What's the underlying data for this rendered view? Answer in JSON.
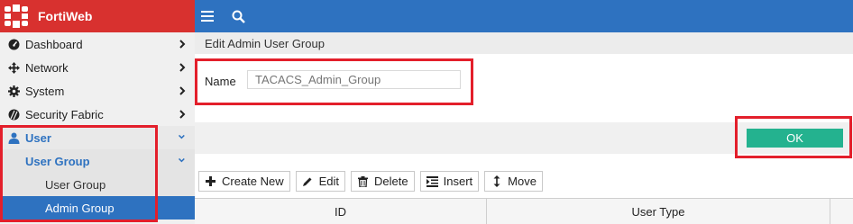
{
  "app": {
    "name": "FortiWeb"
  },
  "sidebar": {
    "items": [
      {
        "label": "Dashboard",
        "icon": "dashboard-icon"
      },
      {
        "label": "Network",
        "icon": "network-icon"
      },
      {
        "label": "System",
        "icon": "gear-icon"
      },
      {
        "label": "Security Fabric",
        "icon": "security-fabric-icon"
      },
      {
        "label": "User",
        "icon": "user-icon"
      }
    ],
    "user_group": {
      "label": "User Group"
    },
    "user_group_children": [
      {
        "label": "User Group"
      },
      {
        "label": "Admin Group"
      }
    ]
  },
  "main": {
    "title": "Edit Admin User Group",
    "name_label": "Name",
    "name_placeholder": "TACACS_Admin_Group",
    "ok_label": "OK",
    "toolbar": {
      "create_new": "Create New",
      "edit": "Edit",
      "delete": "Delete",
      "insert": "Insert",
      "move": "Move"
    },
    "table": {
      "columns": [
        "ID",
        "User Type"
      ]
    }
  },
  "colors": {
    "topbar": "#2e72c0",
    "brand": "#d8312f",
    "ok_button": "#24b28f",
    "highlight": "#e31f2b"
  }
}
